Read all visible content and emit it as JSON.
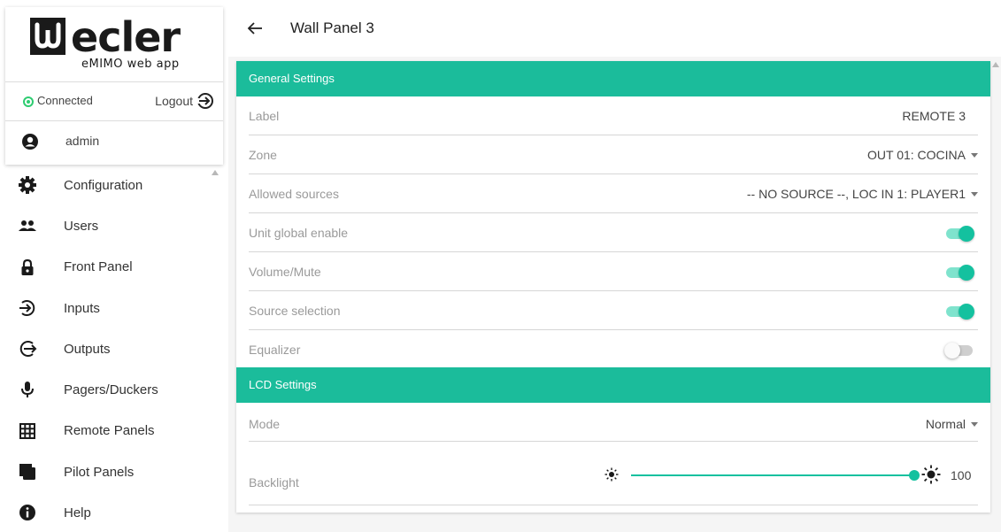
{
  "brand": {
    "logo_text": "ecler",
    "logo_subtitle": "eMIMO web app"
  },
  "session": {
    "status": "Connected",
    "logout_label": "Logout",
    "username": "admin"
  },
  "nav": [
    {
      "label": "Configuration",
      "icon": "gear-icon"
    },
    {
      "label": "Users",
      "icon": "users-icon"
    },
    {
      "label": "Front Panel",
      "icon": "lock-icon"
    },
    {
      "label": "Inputs",
      "icon": "input-icon"
    },
    {
      "label": "Outputs",
      "icon": "output-icon"
    },
    {
      "label": "Pagers/Duckers",
      "icon": "microphone-icon"
    },
    {
      "label": "Remote Panels",
      "icon": "grid-icon"
    },
    {
      "label": "Pilot Panels",
      "icon": "pilot-panel-icon"
    },
    {
      "label": "Help",
      "icon": "info-icon"
    }
  ],
  "header": {
    "title": "Wall Panel 3"
  },
  "general": {
    "title": "General Settings",
    "label": {
      "name": "Label",
      "value": "REMOTE 3"
    },
    "zone": {
      "name": "Zone",
      "value": "OUT 01: COCINA"
    },
    "allowed_sources": {
      "name": "Allowed sources",
      "value": "-- NO SOURCE --, LOC IN 1: PLAYER1"
    },
    "unit_global_enable": {
      "name": "Unit global enable",
      "on": true
    },
    "volume_mute": {
      "name": "Volume/Mute",
      "on": true
    },
    "source_selection": {
      "name": "Source selection",
      "on": true
    },
    "equalizer": {
      "name": "Equalizer",
      "on": false
    }
  },
  "lcd": {
    "title": "LCD Settings",
    "mode": {
      "name": "Mode",
      "value": "Normal"
    },
    "backlight": {
      "name": "Backlight",
      "value": "100",
      "level": 100,
      "min": 0,
      "max": 100
    }
  },
  "colors": {
    "accent": "#1bbc9b",
    "toggle_on": "#14c19f",
    "status_ok": "#2ecc71"
  }
}
